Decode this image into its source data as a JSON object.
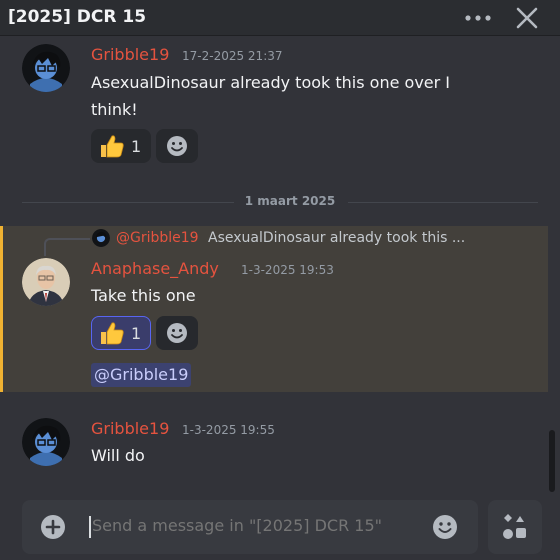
{
  "window": {
    "title": "[2025] DCR 15"
  },
  "messages": [
    {
      "author": "Gribble19",
      "timestamp": "17-2-2025 21:37",
      "text_line1": "AsexualDinosaur already took this one over I",
      "text_line2": "think!",
      "reaction": {
        "emoji": "thumbs-up",
        "count": "1"
      }
    },
    {
      "author": "Anaphase_Andy",
      "timestamp": "1-3-2025 19:53",
      "text": "Take this one",
      "reply_to": {
        "author": "@Gribble19",
        "text": "AsexualDinosaur already took this ..."
      },
      "reaction": {
        "emoji": "thumbs-up",
        "count": "1"
      },
      "mention": "@Gribble19"
    },
    {
      "author": "Gribble19",
      "timestamp": "1-3-2025 19:55",
      "text": "Will do"
    }
  ],
  "date_divider": "1 maart 2025",
  "composer": {
    "placeholder": "Send a message in \"[2025] DCR 15\""
  },
  "colors": {
    "username": "#e5533f",
    "mention_bg": "#3c4270",
    "highlight_bar": "#f0b232",
    "background": "#323339"
  },
  "icons": [
    "more-icon",
    "close-icon",
    "thumbs-up-icon",
    "add-reaction-icon",
    "plus-icon",
    "emoji-icon",
    "apps-icon"
  ]
}
